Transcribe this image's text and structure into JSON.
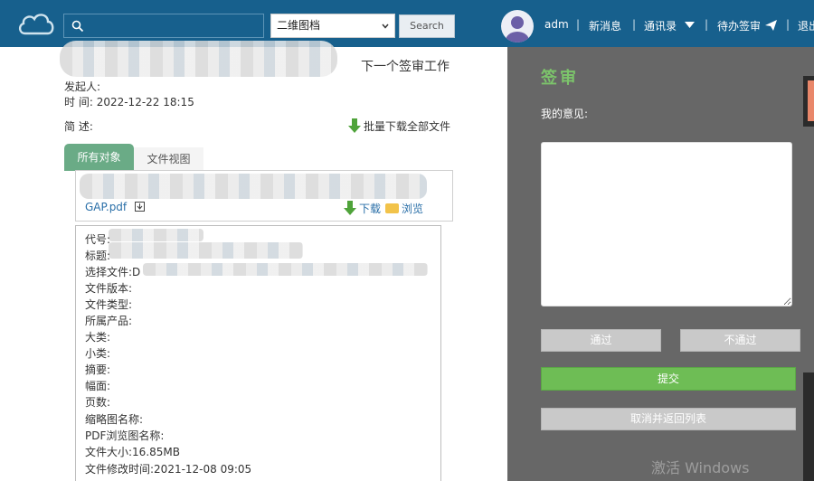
{
  "header": {
    "search_placeholder": "",
    "category_select": "二维图档",
    "search_button": "Search",
    "user": "adm",
    "nav": [
      "新消息",
      "通讯录",
      "待办签审",
      "退出"
    ],
    "separator": "|"
  },
  "main": {
    "next_work": "下一个签审工作",
    "initiator_label": "发起人:",
    "time_label": "时  间:",
    "time_value": "2022-12-22 18:15",
    "summary_label": "简  述:",
    "batch_download": "批量下载全部文件",
    "tabs": [
      "所有对象",
      "文件视图"
    ],
    "file_name": "GAP.pdf",
    "download": "下载",
    "browse": "浏览",
    "details": [
      "代号:",
      "标题:",
      "选择文件:D",
      "文件版本:",
      "文件类型:",
      "所属产品:",
      "大类:",
      "小类:",
      "摘要:",
      "幅面:",
      "页数:",
      "缩略图名称:",
      "PDF浏览图名称:",
      "文件大小:16.85MB",
      "文件修改时间:2021-12-08 09:05"
    ]
  },
  "review": {
    "title": "签审",
    "opinion_label": "我的意见:",
    "opinion_value": "",
    "approve": "通过",
    "reject": "不通过",
    "submit": "提交",
    "cancel": "取消并返回列表",
    "watermark": "激活 Windows"
  },
  "colors": {
    "topbar": "#17608d",
    "tab_active": "#6aab86",
    "submit": "#6ebd55",
    "review_title": "#7cc46b",
    "panel": "#676767"
  }
}
